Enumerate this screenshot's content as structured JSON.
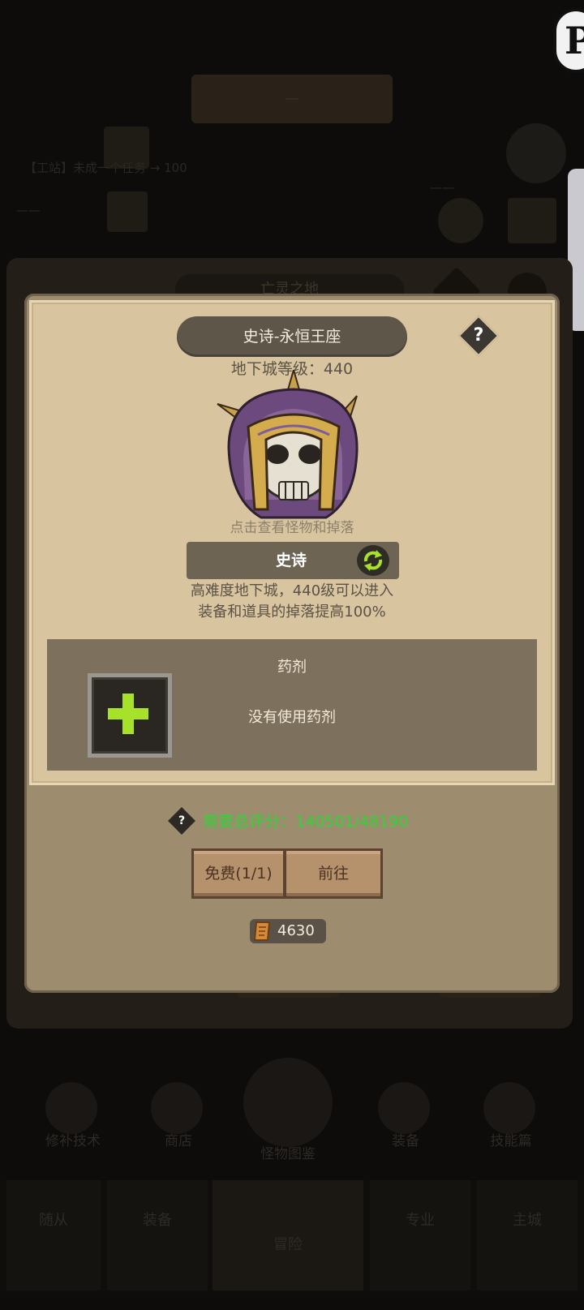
{
  "background": {
    "top_banner": "—",
    "top_lines": [
      "【工站】未成一个任务 → 100",
      "——",
      "——"
    ],
    "panel_title": "亡灵之地",
    "nav": [
      "修补技术",
      "商店",
      "怪物图鉴",
      "装备",
      "技能篇"
    ],
    "bottom_tabs": [
      "随从",
      "装备",
      "",
      "专业",
      "主城"
    ],
    "bottom_center": "冒险"
  },
  "dialog": {
    "title": "史诗-永恒王座",
    "help_symbol": "?",
    "dungeon_level_label": "地下城等级：440",
    "boss_hint": "点击查看怪物和掉落",
    "difficulty": "史诗",
    "description_line1": "高难度地下城，440级可以进入",
    "description_line2": "装备和道具的掉落提高100%",
    "potion": {
      "title": "药剂",
      "empty_text": "没有使用药剂"
    },
    "score": {
      "help_symbol": "?",
      "text": "需要总评分：140501/48190",
      "color": "#2fd436"
    },
    "buttons": {
      "free": "免费(1/1)",
      "go": "前往"
    },
    "cost_value": "4630"
  },
  "colors": {
    "parchment": "#d8c5a0",
    "dialog_frame": "#9d8d6e",
    "pill": "#5d5649",
    "accent_green": "#2fd436",
    "plus_green": "#a7e22b"
  },
  "icons": [
    "help-icon",
    "refresh-icon",
    "plus-icon",
    "scroll-ticket-icon",
    "settings-icon"
  ]
}
